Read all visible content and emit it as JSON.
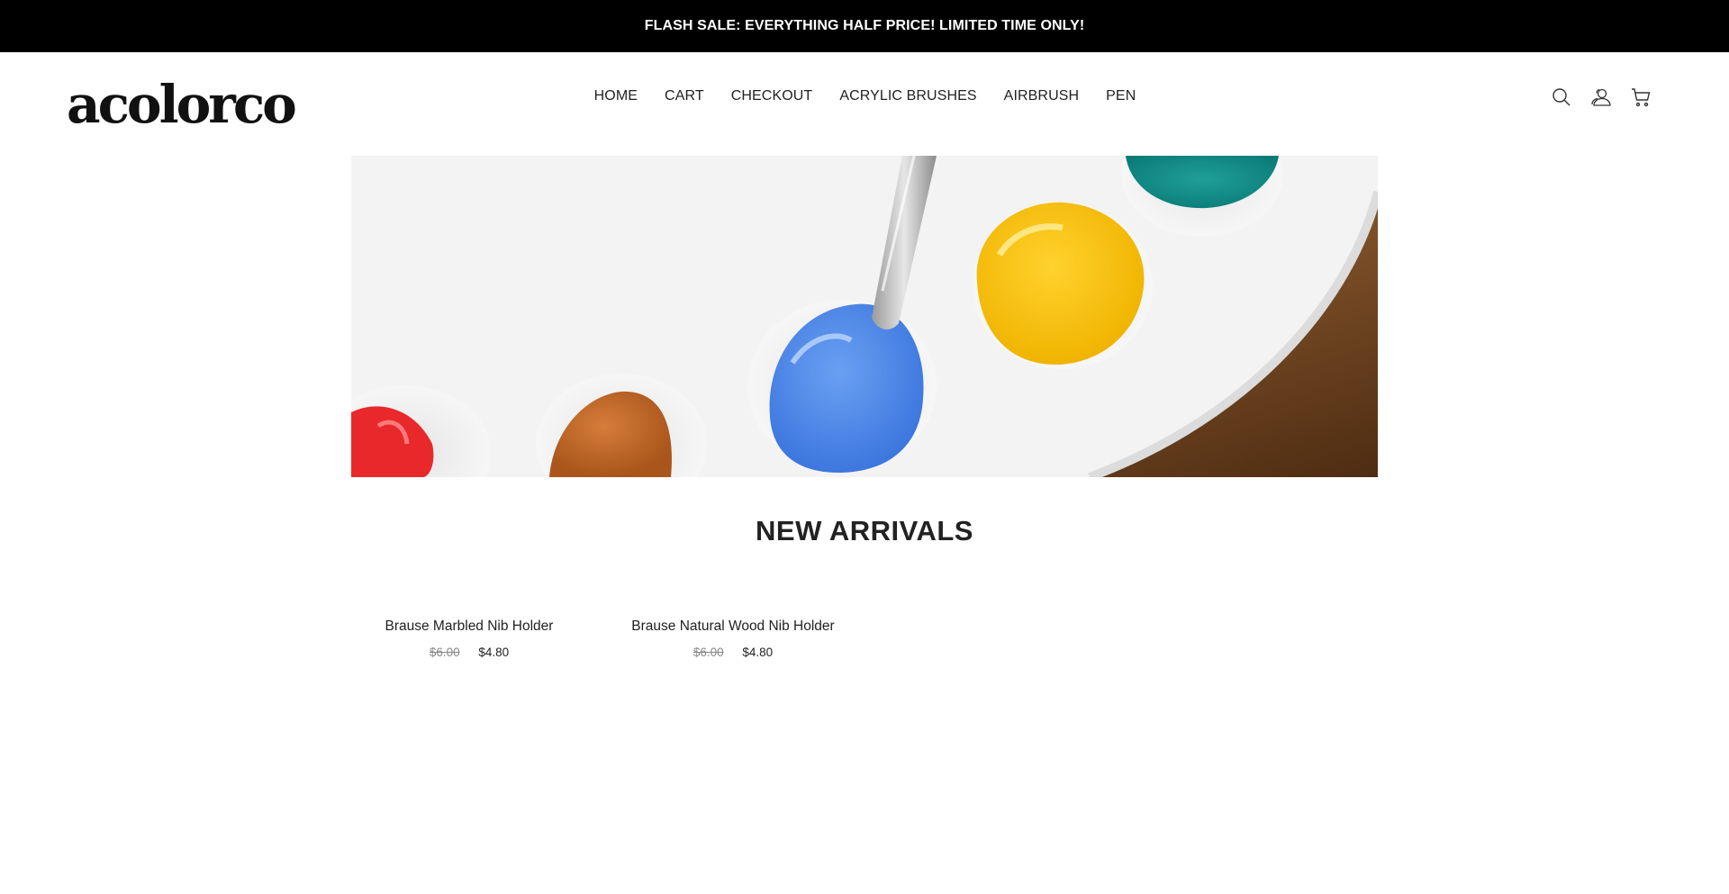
{
  "announcement": {
    "text": "FLASH SALE: EVERYTHING HALF PRICE! LIMITED TIME ONLY!"
  },
  "brand": {
    "logo_text": "acolorco"
  },
  "nav": {
    "items": [
      {
        "label": "HOME"
      },
      {
        "label": "CART"
      },
      {
        "label": "CHECKOUT"
      },
      {
        "label": "ACRYLIC BRUSHES"
      },
      {
        "label": "AIRBRUSH"
      },
      {
        "label": "PEN"
      }
    ]
  },
  "header_icons": [
    "search-icon",
    "account-icon",
    "cart-icon"
  ],
  "section": {
    "title": "NEW ARRIVALS"
  },
  "products": [
    {
      "name": "Brause Marbled Nib Holder",
      "old_price": "$6.00",
      "price": "$4.80"
    },
    {
      "name": "Brause Natural Wood Nib Holder",
      "old_price": "$6.00",
      "price": "$4.80"
    }
  ],
  "colors": {
    "announcement_bg": "#000000",
    "announcement_text": "#ffffff",
    "text": "#222222",
    "muted_price": "#888888"
  }
}
